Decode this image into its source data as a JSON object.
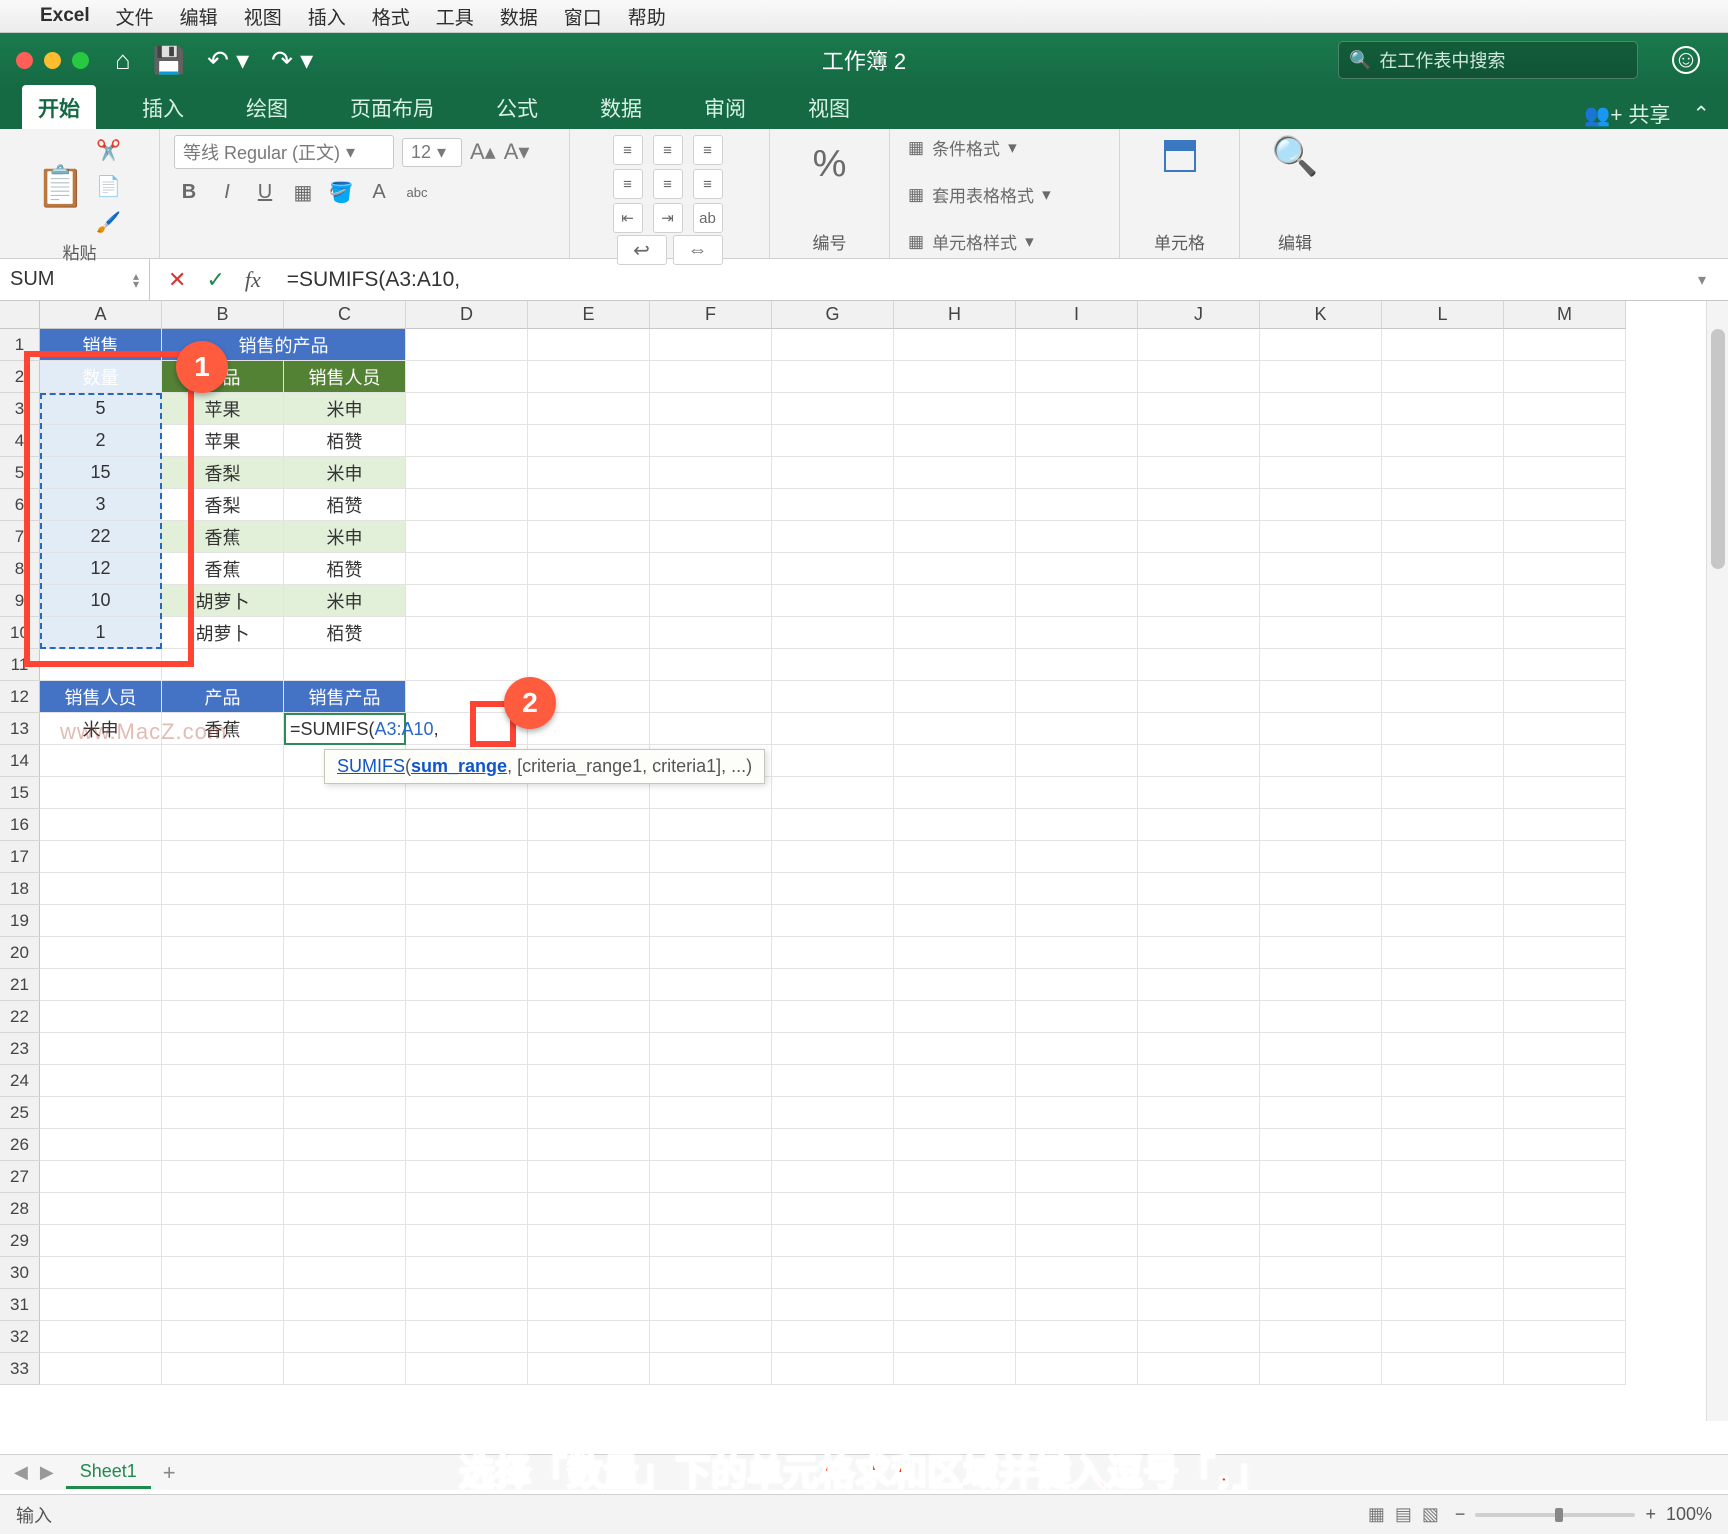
{
  "mac_menu": {
    "app": "Excel",
    "items": [
      "文件",
      "编辑",
      "视图",
      "插入",
      "格式",
      "工具",
      "数据",
      "窗口",
      "帮助"
    ]
  },
  "titlebar": {
    "title": "工作簿 2",
    "search_placeholder": "在工作表中搜索"
  },
  "ribbon": {
    "tabs": [
      "开始",
      "插入",
      "绘图",
      "页面布局",
      "公式",
      "数据",
      "审阅",
      "视图"
    ],
    "share": "共享",
    "paste": "粘贴",
    "font_name": "等线 Regular (正文)",
    "font_size": "12",
    "number_label": "编号",
    "cells_label": "单元格",
    "edit_label": "编辑",
    "cond_format": "条件格式",
    "table_format": "套用表格格式",
    "cell_style": "单元格样式"
  },
  "formula_bar": {
    "name": "SUM",
    "formula": "=SUMIFS(A3:A10,"
  },
  "columns": [
    "A",
    "B",
    "C",
    "D",
    "E",
    "F",
    "G",
    "H",
    "I",
    "J",
    "K",
    "L",
    "M"
  ],
  "row_count": 33,
  "table": {
    "title1": "销售",
    "title2": "销售的产品",
    "h_qty": "数量",
    "h_prod": "产品",
    "h_person": "销售人员",
    "rows": [
      {
        "q": "5",
        "p": "苹果",
        "s": "米申"
      },
      {
        "q": "2",
        "p": "苹果",
        "s": "栢赞"
      },
      {
        "q": "15",
        "p": "香梨",
        "s": "米申"
      },
      {
        "q": "3",
        "p": "香梨",
        "s": "栢赞"
      },
      {
        "q": "22",
        "p": "香蕉",
        "s": "米申"
      },
      {
        "q": "12",
        "p": "香蕉",
        "s": "栢赞"
      },
      {
        "q": "10",
        "p": "胡萝卜",
        "s": "米申"
      },
      {
        "q": "1",
        "p": "胡萝卜",
        "s": "栢赞"
      }
    ],
    "h2_person": "销售人员",
    "h2_prod": "产品",
    "h2_sale": "销售产品",
    "r2_person": "米申",
    "r2_prod": "香蕉"
  },
  "edit_cell": {
    "prefix": "=SUMIFS(",
    "ref": "A3:A10",
    "suffix": ","
  },
  "tooltip": {
    "fn": "SUMIFS",
    "arg": "sum_range",
    "rest": ", [criteria_range1, criteria1], ...)"
  },
  "badges": {
    "one": "1",
    "two": "2"
  },
  "sheet_tabs": {
    "name": "Sheet1"
  },
  "caption": "选择「数量」下的单元格求和区域并键入逗号「，」",
  "status": {
    "mode": "输入",
    "zoom": "100%"
  },
  "watermark": "www.MacZ.com"
}
